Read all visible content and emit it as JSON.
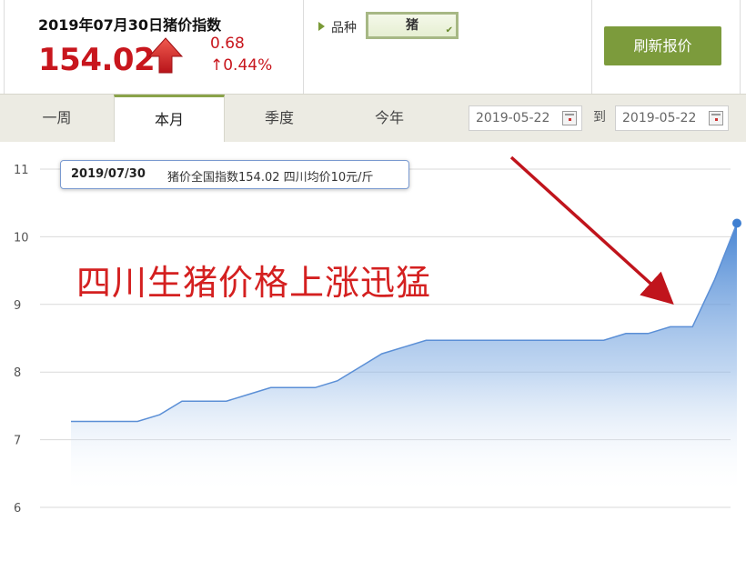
{
  "header": {
    "index_title": "2019年07月30日猪价指数",
    "index_value": "154.02",
    "change": "0.68",
    "change_pct": "↑0.44%",
    "variety_label": "品种",
    "variety_value": "猪",
    "refresh_label": "刷新报价"
  },
  "tabs": [
    {
      "label": "一周"
    },
    {
      "label": "本月",
      "active": true
    },
    {
      "label": "季度"
    },
    {
      "label": "今年"
    }
  ],
  "date_range": {
    "start": "2019-05-22",
    "separator": "到",
    "end": "2019-05-22"
  },
  "tooltip": {
    "date": "2019/07/30",
    "text": "猪价全国指数154.02 四川均价10元/斤"
  },
  "annotation": {
    "headline": "四川生猪价格上涨迅猛",
    "arrow_color": "#c0141c"
  },
  "colors": {
    "accent_green": "#7c9b3c",
    "price_red": "#c8161d",
    "series_blue": "#3f7fd1"
  },
  "chart_data": {
    "type": "area",
    "title": "",
    "xlabel": "",
    "ylabel": "",
    "ylim": [
      6,
      11
    ],
    "yticks": [
      6,
      7,
      8,
      9,
      10,
      11
    ],
    "grid": true,
    "series": [
      {
        "values": [
          7.27,
          7.27,
          7.27,
          7.27,
          7.37,
          7.57,
          7.57,
          7.57,
          7.67,
          7.77,
          7.77,
          7.77,
          7.87,
          8.07,
          8.27,
          8.37,
          8.47,
          8.47,
          8.47,
          8.47,
          8.47,
          8.47,
          8.47,
          8.47,
          8.47,
          8.57,
          8.57,
          8.67,
          8.67,
          9.37,
          10.2
        ]
      }
    ]
  }
}
